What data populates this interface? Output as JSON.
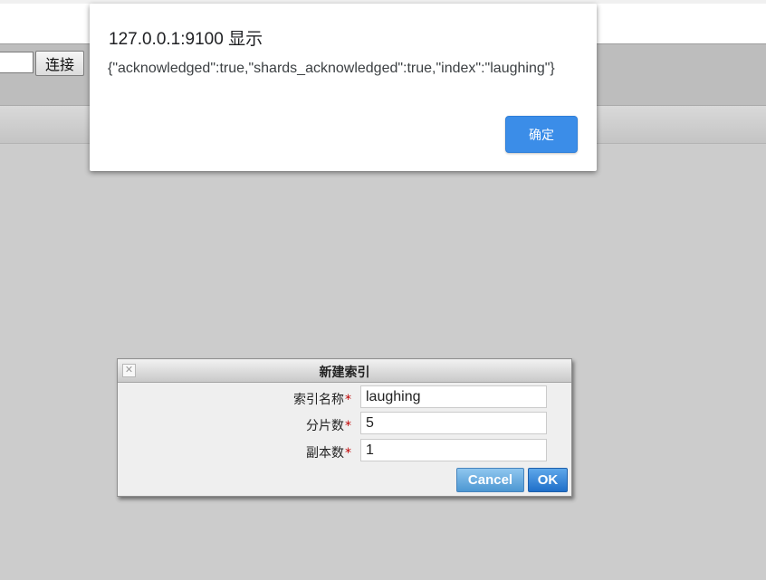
{
  "toolbar": {
    "connect_label": "连接"
  },
  "alert": {
    "title": "127.0.0.1:9100 显示",
    "message": "{\"acknowledged\":true,\"shards_acknowledged\":true,\"index\":\"laughing\"}",
    "ok_label": "确定",
    "ok_color": "#3b8de8"
  },
  "dialog": {
    "title": "新建索引",
    "close_icon": "close-icon",
    "fields": [
      {
        "label": "索引名称",
        "required": "*",
        "value": "laughing"
      },
      {
        "label": "分片数",
        "required": "*",
        "value": "5"
      },
      {
        "label": "副本数",
        "required": "*",
        "value": "1"
      }
    ],
    "cancel_label": "Cancel",
    "ok_label": "OK",
    "required_color": "#c00000"
  }
}
